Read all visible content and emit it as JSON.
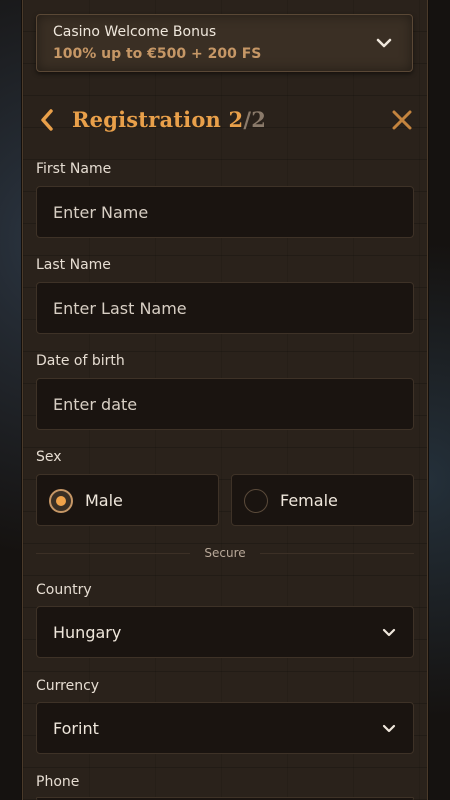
{
  "bonus": {
    "title": "Casino Welcome Bonus",
    "subtitle": "100% up to €500 + 200 FS",
    "chevron_icon": "chevron-down-icon"
  },
  "header": {
    "title": "Registration",
    "step": "2",
    "separator": "/",
    "total": "2",
    "back_icon": "chevron-left-icon",
    "close_icon": "close-icon"
  },
  "form": {
    "first_name": {
      "label": "First Name",
      "placeholder": "Enter Name",
      "value": ""
    },
    "last_name": {
      "label": "Last Name",
      "placeholder": "Enter Last Name",
      "value": ""
    },
    "dob": {
      "label": "Date of birth",
      "placeholder": "Enter date",
      "value": ""
    },
    "sex": {
      "label": "Sex",
      "options": [
        {
          "label": "Male",
          "selected": true
        },
        {
          "label": "Female",
          "selected": false
        }
      ]
    },
    "divider_text": "Secure",
    "country": {
      "label": "Country",
      "value": "Hungary"
    },
    "currency": {
      "label": "Currency",
      "value": "Forint"
    },
    "phone": {
      "label": "Phone"
    }
  },
  "colors": {
    "accent": "#e9a04a",
    "bonus_highlight": "#c69766",
    "panel": "#2a221b",
    "field_bg": "#1a1410",
    "muted": "#8a7a6a"
  }
}
